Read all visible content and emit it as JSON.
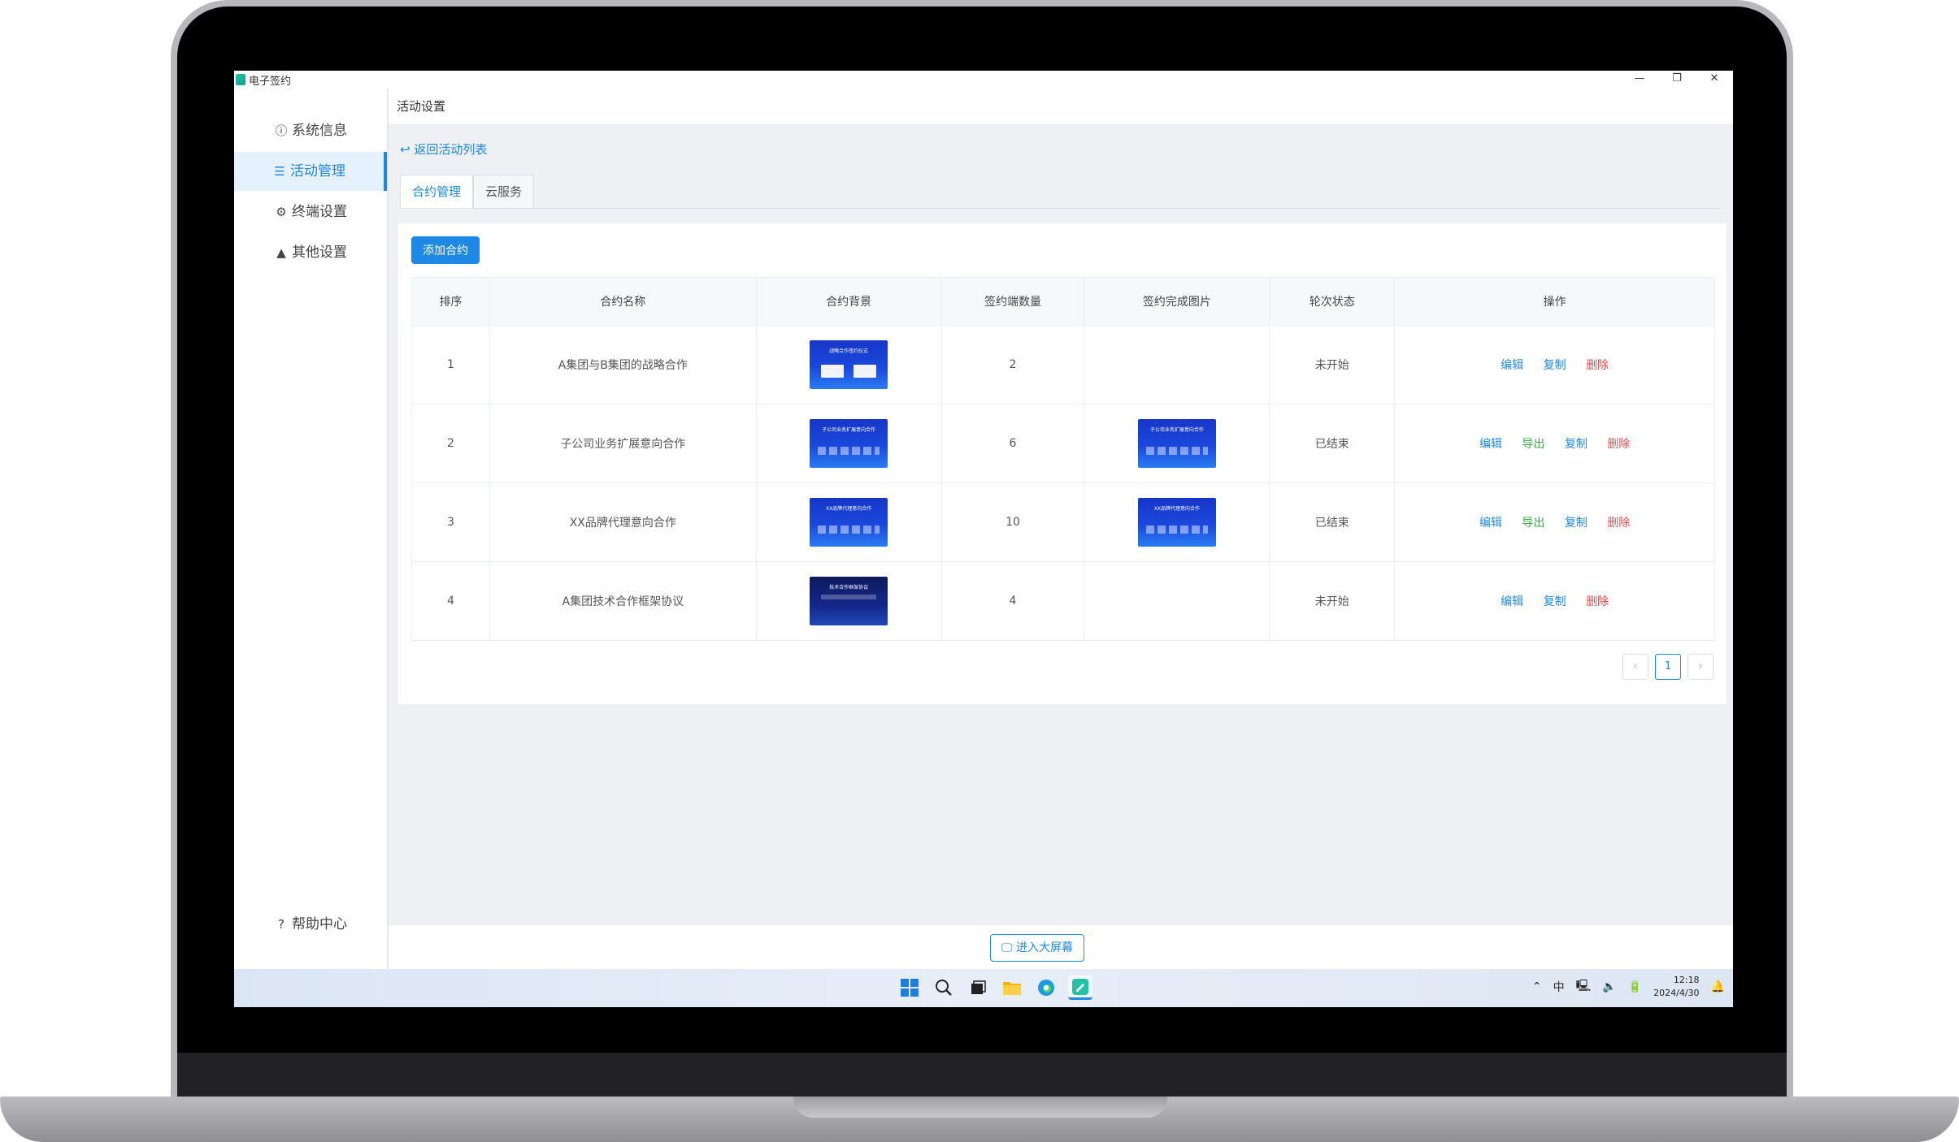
{
  "app": {
    "title": "电子签约",
    "window_controls": [
      "—",
      "❐",
      "✕"
    ]
  },
  "sidebar": {
    "items": [
      {
        "label": "系统信息",
        "icon": "info-icon",
        "glyph": "ⓘ"
      },
      {
        "label": "活动管理",
        "icon": "list-icon",
        "glyph": "☰"
      },
      {
        "label": "终端设置",
        "icon": "gear-icon",
        "glyph": "⚙"
      },
      {
        "label": "其他设置",
        "icon": "warning-icon",
        "glyph": "▲"
      }
    ],
    "help": {
      "label": "帮助中心",
      "icon": "help-icon",
      "glyph": "?"
    }
  },
  "header": {
    "title": "活动设置",
    "back_label": "返回活动列表"
  },
  "tabs": [
    {
      "label": "合约管理"
    },
    {
      "label": "云服务"
    }
  ],
  "toolbar": {
    "add_label": "添加合约"
  },
  "table": {
    "columns": [
      "排序",
      "合约名称",
      "合约背景",
      "签约端数量",
      "签约完成图片",
      "轮次状态",
      "操作"
    ],
    "rows": [
      {
        "order": "1",
        "name": "A集团与B集团的战略合作",
        "bg_title": "战略合作签约仪式",
        "count": "2",
        "done_img": false,
        "status": "未开始",
        "actions": [
          "编辑",
          "复制",
          "删除"
        ]
      },
      {
        "order": "2",
        "name": "子公司业务扩展意向合作",
        "bg_title": "子公司业务扩展意向合作",
        "count": "6",
        "done_img": true,
        "status": "已结束",
        "actions": [
          "编辑",
          "导出",
          "复制",
          "删除"
        ]
      },
      {
        "order": "3",
        "name": "XX品牌代理意向合作",
        "bg_title": "XX品牌代理意向合作",
        "count": "10",
        "done_img": true,
        "status": "已结束",
        "actions": [
          "编辑",
          "导出",
          "复制",
          "删除"
        ]
      },
      {
        "order": "4",
        "name": "A集团技术合作框架协议",
        "bg_title": "技术合作框架协议",
        "count": "4",
        "done_img": false,
        "status": "未开始",
        "actions": [
          "编辑",
          "复制",
          "删除"
        ]
      }
    ]
  },
  "pagination": {
    "prev": "‹",
    "current": "1",
    "next": "›"
  },
  "footer": {
    "bigscreen_label": "进入大屏幕"
  },
  "taskbar": {
    "tray": {
      "ime": "中",
      "time": "12:18",
      "date": "2024/4/30"
    }
  },
  "colors": {
    "accent": "#1e88e5",
    "export": "#3aa948",
    "delete": "#f04a4a"
  }
}
